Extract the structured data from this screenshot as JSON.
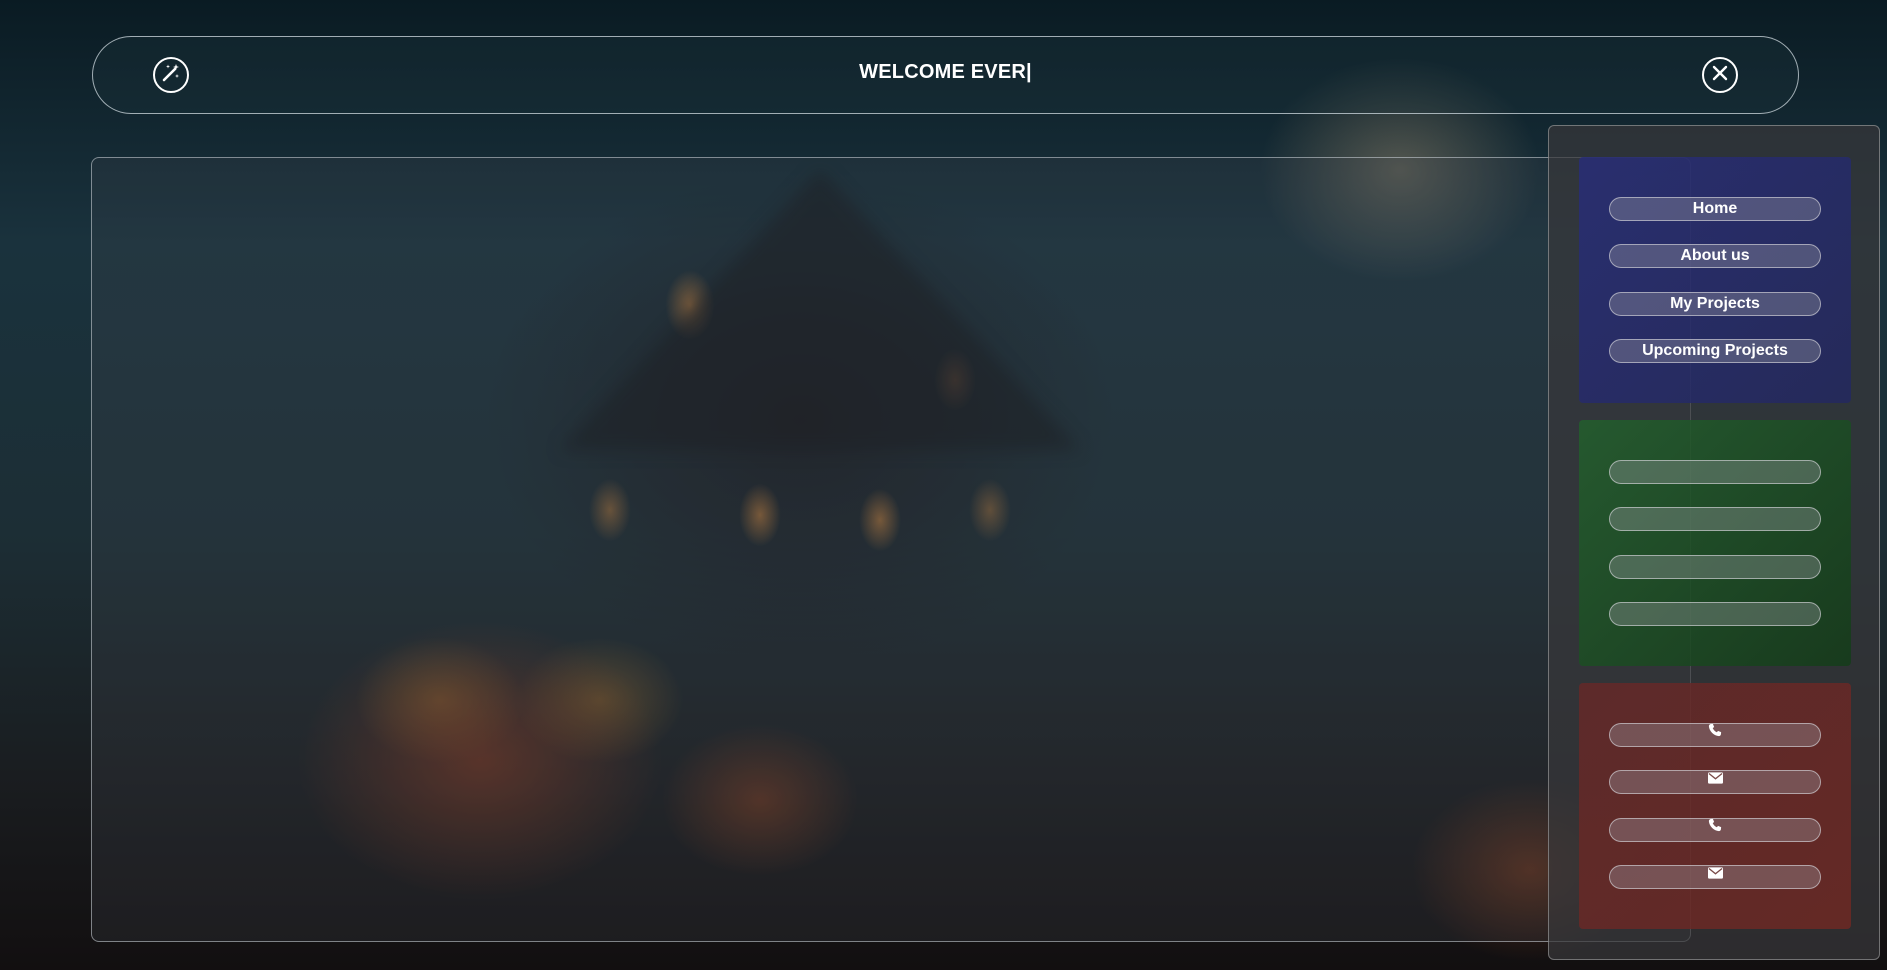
{
  "header": {
    "title": "WELCOME EVER|",
    "left_icon": "magic-wand-icon",
    "right_icon": "close-icon"
  },
  "sidebar": {
    "nav_group": {
      "color": "#2a2f78",
      "items": [
        {
          "label": "Home"
        },
        {
          "label": "About us"
        },
        {
          "label": "My Projects"
        },
        {
          "label": "Upcoming Projects"
        }
      ]
    },
    "empty_group": {
      "color": "#235f2d",
      "items": [
        {
          "label": ""
        },
        {
          "label": ""
        },
        {
          "label": ""
        },
        {
          "label": ""
        }
      ]
    },
    "contact_group": {
      "color": "#6e2823",
      "items": [
        {
          "icon": "phone-icon"
        },
        {
          "icon": "envelope-icon"
        },
        {
          "icon": "phone-icon"
        },
        {
          "icon": "envelope-icon"
        }
      ]
    }
  }
}
